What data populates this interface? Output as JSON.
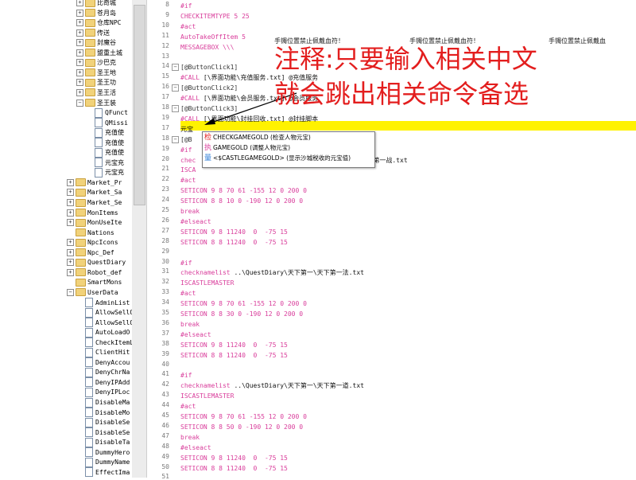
{
  "tree": {
    "items": [
      {
        "label": "比奇城",
        "expander": "+",
        "icon": "folder",
        "indent": 1
      },
      {
        "label": "苍月岛",
        "expander": "+",
        "icon": "folder",
        "indent": 1
      },
      {
        "label": "仓库NPC",
        "expander": "+",
        "icon": "folder",
        "indent": 1
      },
      {
        "label": "传送",
        "expander": "+",
        "icon": "folder",
        "indent": 1
      },
      {
        "label": "封魔谷",
        "expander": "+",
        "icon": "folder",
        "indent": 1
      },
      {
        "label": "盟重土城",
        "expander": "+",
        "icon": "folder",
        "indent": 1
      },
      {
        "label": "沙巴克",
        "expander": "+",
        "icon": "folder",
        "indent": 1
      },
      {
        "label": "圣王地",
        "expander": "+",
        "icon": "folder",
        "indent": 1
      },
      {
        "label": "圣王功",
        "expander": "+",
        "icon": "folder",
        "indent": 1
      },
      {
        "label": "圣王活",
        "expander": "+",
        "icon": "folder",
        "indent": 1
      },
      {
        "label": "圣王装",
        "expander": "−",
        "icon": "folder",
        "indent": 1
      },
      {
        "label": "QFunct",
        "expander": "",
        "icon": "file",
        "indent": 2
      },
      {
        "label": "QMissi",
        "expander": "",
        "icon": "file",
        "indent": 2
      },
      {
        "label": "充值使",
        "expander": "",
        "icon": "file",
        "indent": 2
      },
      {
        "label": "充值使",
        "expander": "",
        "icon": "file",
        "indent": 2
      },
      {
        "label": "充值使",
        "expander": "",
        "icon": "file",
        "indent": 2
      },
      {
        "label": "元宝充",
        "expander": "",
        "icon": "file",
        "indent": 2
      },
      {
        "label": "元宝充",
        "expander": "",
        "icon": "file",
        "indent": 2
      },
      {
        "label": "Market_Pr",
        "expander": "+",
        "icon": "folder",
        "indent": 0
      },
      {
        "label": "Market_Sa",
        "expander": "+",
        "icon": "folder",
        "indent": 0
      },
      {
        "label": "Market_Se",
        "expander": "+",
        "icon": "folder",
        "indent": 0
      },
      {
        "label": "MonItems",
        "expander": "+",
        "icon": "folder",
        "indent": 0
      },
      {
        "label": "MonUseIte",
        "expander": "+",
        "icon": "folder",
        "indent": 0
      },
      {
        "label": "Nations",
        "expander": "",
        "icon": "folder",
        "indent": 0
      },
      {
        "label": "NpcIcons",
        "expander": "+",
        "icon": "folder",
        "indent": 0
      },
      {
        "label": "Npc_Def",
        "expander": "+",
        "icon": "folder",
        "indent": 0
      },
      {
        "label": "QuestDiary",
        "expander": "+",
        "icon": "folder",
        "indent": 0
      },
      {
        "label": "Robot_def",
        "expander": "+",
        "icon": "folder",
        "indent": 0
      },
      {
        "label": "SmartMons",
        "expander": "",
        "icon": "folder",
        "indent": 0
      },
      {
        "label": "UserData",
        "expander": "−",
        "icon": "folder",
        "indent": 0
      },
      {
        "label": "AdminList",
        "expander": "",
        "icon": "file",
        "indent": 1
      },
      {
        "label": "AllowSellO",
        "expander": "",
        "icon": "file",
        "indent": 1
      },
      {
        "label": "AllowSellO",
        "expander": "",
        "icon": "file",
        "indent": 1
      },
      {
        "label": "AutoLoadO",
        "expander": "",
        "icon": "file",
        "indent": 1
      },
      {
        "label": "CheckItemL",
        "expander": "",
        "icon": "file",
        "indent": 1
      },
      {
        "label": "ClientHit",
        "expander": "",
        "icon": "file",
        "indent": 1
      },
      {
        "label": "DenyAccou",
        "expander": "",
        "icon": "file",
        "indent": 1
      },
      {
        "label": "DenyChrNa",
        "expander": "",
        "icon": "file",
        "indent": 1
      },
      {
        "label": "DenyIPAdd",
        "expander": "",
        "icon": "file",
        "indent": 1
      },
      {
        "label": "DenyIPLoc",
        "expander": "",
        "icon": "file",
        "indent": 1
      },
      {
        "label": "DisableMa",
        "expander": "",
        "icon": "file",
        "indent": 1
      },
      {
        "label": "DisableMo",
        "expander": "",
        "icon": "file",
        "indent": 1
      },
      {
        "label": "DisableSe",
        "expander": "",
        "icon": "file",
        "indent": 1
      },
      {
        "label": "DisableSe",
        "expander": "",
        "icon": "file",
        "indent": 1
      },
      {
        "label": "DisableTa",
        "expander": "",
        "icon": "file",
        "indent": 1
      },
      {
        "label": "DummyHero",
        "expander": "",
        "icon": "file",
        "indent": 1
      },
      {
        "label": "DummyName",
        "expander": "",
        "icon": "file",
        "indent": 1
      },
      {
        "label": "EffectIma",
        "expander": "",
        "icon": "file",
        "indent": 1
      }
    ]
  },
  "editor": {
    "lines": [
      {
        "n": "8",
        "fold": "",
        "segs": [
          {
            "t": "#if",
            "c": "kw"
          }
        ]
      },
      {
        "n": "9",
        "fold": "",
        "segs": [
          {
            "t": "CHECKITEMTYPE 5 25",
            "c": "kw"
          }
        ]
      },
      {
        "n": "10",
        "fold": "",
        "segs": [
          {
            "t": "#act",
            "c": "kw"
          }
        ]
      },
      {
        "n": "11",
        "fold": "",
        "segs": [
          {
            "t": "AutoTakeOffItem 5",
            "c": "kw"
          }
        ]
      },
      {
        "n": "12",
        "fold": "",
        "segs": [
          {
            "t": "MESSAGEBOX \\\\\\",
            "c": "kw"
          }
        ]
      },
      {
        "n": "13",
        "fold": "",
        "segs": []
      },
      {
        "n": "14",
        "fold": "−",
        "segs": [
          {
            "t": "[@ButtonClick1]",
            "c": "sect"
          }
        ]
      },
      {
        "n": "15",
        "fold": "",
        "segs": [
          {
            "t": "#CALL ",
            "c": "kw"
          },
          {
            "t": "[\\界面功能\\充值服务.txt] @充值服务",
            "c": "tx"
          }
        ]
      },
      {
        "n": "16",
        "fold": "−",
        "segs": [
          {
            "t": "[@ButtonClick2]",
            "c": "sect"
          }
        ]
      },
      {
        "n": "17",
        "fold": "",
        "segs": [
          {
            "t": "#CALL ",
            "c": "kw"
          },
          {
            "t": "[\\界面功能\\会员服务.txt] @会员服务",
            "c": "tx"
          }
        ]
      },
      {
        "n": "18",
        "fold": "−",
        "segs": [
          {
            "t": "[@ButtonClick3]",
            "c": "sect"
          }
        ]
      },
      {
        "n": "19",
        "fold": "",
        "segs": [
          {
            "t": "#CALL ",
            "c": "kw"
          },
          {
            "t": "[\\界面功能\\封挂回收.txt] @封挂脚本",
            "c": "tx"
          }
        ]
      },
      {
        "n": "17",
        "fold": "",
        "segs": [
          {
            "t": "元宝",
            "c": "tx"
          }
        ]
      },
      {
        "n": "18",
        "fold": "−",
        "segs": [
          {
            "t": "[@B",
            "c": "sect"
          }
        ]
      },
      {
        "n": "19",
        "fold": "",
        "segs": [
          {
            "t": "#if",
            "c": "kw"
          }
        ]
      },
      {
        "n": "20",
        "fold": "",
        "segs": [
          {
            "t": "chec",
            "c": "kw"
          },
          {
            "t": "                                           天下第一战.txt",
            "c": "tx"
          }
        ]
      },
      {
        "n": "21",
        "fold": "",
        "segs": [
          {
            "t": "ISCA",
            "c": "kw"
          }
        ]
      },
      {
        "n": "22",
        "fold": "",
        "segs": [
          {
            "t": "#act",
            "c": "kw"
          }
        ]
      },
      {
        "n": "23",
        "fold": "",
        "segs": [
          {
            "t": "SETICON 9 8 70 61 -155 12 0 200 0",
            "c": "kw"
          }
        ]
      },
      {
        "n": "24",
        "fold": "",
        "segs": [
          {
            "t": "SETICON 8 8 10 0 -190 12 0 200 0",
            "c": "kw"
          }
        ]
      },
      {
        "n": "25",
        "fold": "",
        "segs": [
          {
            "t": "break",
            "c": "kw"
          }
        ]
      },
      {
        "n": "26",
        "fold": "",
        "segs": [
          {
            "t": "#elseact",
            "c": "kw"
          }
        ]
      },
      {
        "n": "27",
        "fold": "",
        "segs": [
          {
            "t": "SETICON 9 8 11240  0  -75 15",
            "c": "kw"
          }
        ]
      },
      {
        "n": "28",
        "fold": "",
        "segs": [
          {
            "t": "SETICON 8 8 11240  0  -75 15",
            "c": "kw"
          }
        ]
      },
      {
        "n": "29",
        "fold": "",
        "segs": []
      },
      {
        "n": "30",
        "fold": "",
        "segs": [
          {
            "t": "#if",
            "c": "kw"
          }
        ]
      },
      {
        "n": "31",
        "fold": "",
        "segs": [
          {
            "t": "checknamelist ",
            "c": "kw"
          },
          {
            "t": "..\\QuestDiary\\天下第一\\天下第一法.txt",
            "c": "tx"
          }
        ]
      },
      {
        "n": "32",
        "fold": "",
        "segs": [
          {
            "t": "ISCASTLEMASTER",
            "c": "kw"
          }
        ]
      },
      {
        "n": "33",
        "fold": "",
        "segs": [
          {
            "t": "#act",
            "c": "kw"
          }
        ]
      },
      {
        "n": "34",
        "fold": "",
        "segs": [
          {
            "t": "SETICON 9 8 70 61 -155 12 0 200 0",
            "c": "kw"
          }
        ]
      },
      {
        "n": "35",
        "fold": "",
        "segs": [
          {
            "t": "SETICON 8 8 30 0 -190 12 0 200 0",
            "c": "kw"
          }
        ]
      },
      {
        "n": "36",
        "fold": "",
        "segs": [
          {
            "t": "break",
            "c": "kw"
          }
        ]
      },
      {
        "n": "37",
        "fold": "",
        "segs": [
          {
            "t": "#elseact",
            "c": "kw"
          }
        ]
      },
      {
        "n": "38",
        "fold": "",
        "segs": [
          {
            "t": "SETICON 9 8 11240  0  -75 15",
            "c": "kw"
          }
        ]
      },
      {
        "n": "39",
        "fold": "",
        "segs": [
          {
            "t": "SETICON 8 8 11240  0  -75 15",
            "c": "kw"
          }
        ]
      },
      {
        "n": "40",
        "fold": "",
        "segs": []
      },
      {
        "n": "41",
        "fold": "",
        "segs": [
          {
            "t": "#if",
            "c": "kw"
          }
        ]
      },
      {
        "n": "42",
        "fold": "",
        "segs": [
          {
            "t": "checknamelist ",
            "c": "kw"
          },
          {
            "t": "..\\QuestDiary\\天下第一\\天下第一道.txt",
            "c": "tx"
          }
        ]
      },
      {
        "n": "43",
        "fold": "",
        "segs": [
          {
            "t": "ISCASTLEMASTER",
            "c": "kw"
          }
        ]
      },
      {
        "n": "44",
        "fold": "",
        "segs": [
          {
            "t": "#act",
            "c": "kw"
          }
        ]
      },
      {
        "n": "45",
        "fold": "",
        "segs": [
          {
            "t": "SETICON 9 8 70 61 -155 12 0 200 0",
            "c": "kw"
          }
        ]
      },
      {
        "n": "46",
        "fold": "",
        "segs": [
          {
            "t": "SETICON 8 8 50 0 -190 12 0 200 0",
            "c": "kw"
          }
        ]
      },
      {
        "n": "47",
        "fold": "",
        "segs": [
          {
            "t": "break",
            "c": "kw"
          }
        ]
      },
      {
        "n": "48",
        "fold": "",
        "segs": [
          {
            "t": "#elseact",
            "c": "kw"
          }
        ]
      },
      {
        "n": "49",
        "fold": "",
        "segs": [
          {
            "t": "SETICON 9 8 11240  0  -75 15",
            "c": "kw"
          }
        ]
      },
      {
        "n": "50",
        "fold": "",
        "segs": [
          {
            "t": "SETICON 8 8 11240  0  -75 15",
            "c": "kw"
          }
        ]
      },
      {
        "n": "51",
        "fold": "",
        "segs": []
      }
    ],
    "message_texts": [
      "手镯位置禁止佩戴血符！",
      "手镯位置禁止佩戴血符！",
      "手镯位置禁止佩戴血"
    ]
  },
  "annotation": {
    "line1": "注释:只要输入相关中文",
    "line2": "就会跳出相关命令备选"
  },
  "autocomplete": {
    "items": [
      {
        "icon": "检",
        "text": "CHECKGAMEGOLD (检查人物元宝)"
      },
      {
        "icon": "执",
        "text": "GAMEGOLD (调整人物元宝)"
      },
      {
        "icon": "量",
        "text": "<$CASTLEGAMEGOLD> (显示沙城税收的元宝值)"
      }
    ]
  },
  "colors": {
    "keyword": "#d93d9b",
    "annotation": "#e31e1e",
    "highlight": "#fff200"
  }
}
